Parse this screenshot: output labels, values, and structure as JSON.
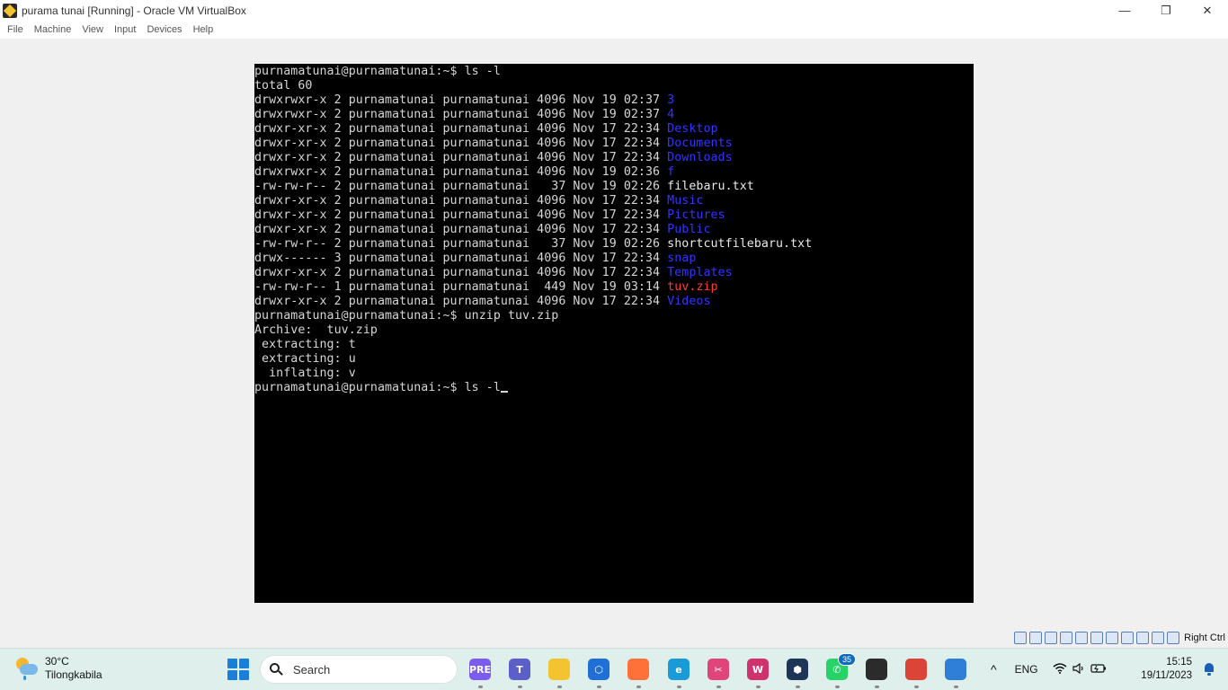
{
  "window": {
    "title": "purama tunai [Running] - Oracle VM VirtualBox",
    "controls": {
      "minimize": "—",
      "restore": "❐",
      "close": "✕"
    }
  },
  "menu": [
    "File",
    "Machine",
    "View",
    "Input",
    "Devices",
    "Help"
  ],
  "terminal": {
    "lines": [
      [
        {
          "t": "purnamatunai@purnamatunai:~$ ls -l",
          "c": ""
        }
      ],
      [
        {
          "t": "total 60",
          "c": ""
        }
      ],
      [
        {
          "t": "drwxrwxr-x 2 purnamatunai purnamatunai 4096 Nov 19 02:37 ",
          "c": ""
        },
        {
          "t": "3",
          "c": "dir"
        }
      ],
      [
        {
          "t": "drwxrwxr-x 2 purnamatunai purnamatunai 4096 Nov 19 02:37 ",
          "c": ""
        },
        {
          "t": "4",
          "c": "dir"
        }
      ],
      [
        {
          "t": "drwxr-xr-x 2 purnamatunai purnamatunai 4096 Nov 17 22:34 ",
          "c": ""
        },
        {
          "t": "Desktop",
          "c": "dir"
        }
      ],
      [
        {
          "t": "drwxr-xr-x 2 purnamatunai purnamatunai 4096 Nov 17 22:34 ",
          "c": ""
        },
        {
          "t": "Documents",
          "c": "dir"
        }
      ],
      [
        {
          "t": "drwxr-xr-x 2 purnamatunai purnamatunai 4096 Nov 17 22:34 ",
          "c": ""
        },
        {
          "t": "Downloads",
          "c": "dir"
        }
      ],
      [
        {
          "t": "drwxrwxr-x 2 purnamatunai purnamatunai 4096 Nov 19 02:36 ",
          "c": ""
        },
        {
          "t": "f",
          "c": "dir"
        }
      ],
      [
        {
          "t": "-rw-rw-r-- 2 purnamatunai purnamatunai   37 Nov 19 02:26 ",
          "c": ""
        },
        {
          "t": "filebaru.txt",
          "c": "file"
        }
      ],
      [
        {
          "t": "drwxr-xr-x 2 purnamatunai purnamatunai 4096 Nov 17 22:34 ",
          "c": ""
        },
        {
          "t": "Music",
          "c": "dir"
        }
      ],
      [
        {
          "t": "drwxr-xr-x 2 purnamatunai purnamatunai 4096 Nov 17 22:34 ",
          "c": ""
        },
        {
          "t": "Pictures",
          "c": "dir"
        }
      ],
      [
        {
          "t": "drwxr-xr-x 2 purnamatunai purnamatunai 4096 Nov 17 22:34 ",
          "c": ""
        },
        {
          "t": "Public",
          "c": "dir"
        }
      ],
      [
        {
          "t": "-rw-rw-r-- 2 purnamatunai purnamatunai   37 Nov 19 02:26 ",
          "c": ""
        },
        {
          "t": "shortcutfilebaru.txt",
          "c": "file"
        }
      ],
      [
        {
          "t": "drwx------ 3 purnamatunai purnamatunai 4096 Nov 17 22:34 ",
          "c": ""
        },
        {
          "t": "snap",
          "c": "dir"
        }
      ],
      [
        {
          "t": "drwxr-xr-x 2 purnamatunai purnamatunai 4096 Nov 17 22:34 ",
          "c": ""
        },
        {
          "t": "Templates",
          "c": "dir"
        }
      ],
      [
        {
          "t": "-rw-rw-r-- 1 purnamatunai purnamatunai  449 Nov 19 03:14 ",
          "c": ""
        },
        {
          "t": "tuv.zip",
          "c": "zip"
        }
      ],
      [
        {
          "t": "drwxr-xr-x 2 purnamatunai purnamatunai 4096 Nov 17 22:34 ",
          "c": ""
        },
        {
          "t": "Videos",
          "c": "dir"
        }
      ],
      [
        {
          "t": "purnamatunai@purnamatunai:~$ unzip tuv.zip",
          "c": ""
        }
      ],
      [
        {
          "t": "Archive:  tuv.zip",
          "c": ""
        }
      ],
      [
        {
          "t": " extracting: t",
          "c": ""
        }
      ],
      [
        {
          "t": " extracting: u",
          "c": ""
        }
      ],
      [
        {
          "t": "  inflating: v",
          "c": ""
        }
      ],
      [
        {
          "t": "purnamatunai@purnamatunai:~$ ls -l",
          "c": "",
          "cursor": true
        }
      ]
    ]
  },
  "status_bar": {
    "icons": [
      "optical-drive-icon",
      "audio-icon",
      "network-icon",
      "usb-icon",
      "shared-folders-icon",
      "display-icon",
      "recording-icon",
      "cpu-icon",
      "guest-additions-icon",
      "mouse-integration-icon",
      "keyboard-icon"
    ],
    "host_key": "Right Ctrl"
  },
  "taskbar": {
    "weather": {
      "temp": "30°C",
      "location": "Tilongkabila"
    },
    "search_placeholder": "Search",
    "apps": [
      {
        "name": "copilot-icon",
        "label": "PRE",
        "color": "#7a5cf0"
      },
      {
        "name": "teams-icon",
        "label": "T",
        "color": "#5b5fc7"
      },
      {
        "name": "file-explorer-icon",
        "label": "",
        "color": "#f4c430"
      },
      {
        "name": "vpn-app-icon",
        "label": "⬡",
        "color": "#1f6fd6"
      },
      {
        "name": "firefox-icon",
        "label": "",
        "color": "#ff7139"
      },
      {
        "name": "edge-icon",
        "label": "e",
        "color": "#1a9bd7"
      },
      {
        "name": "snipping-tool-icon",
        "label": "✂",
        "color": "#e0447b"
      },
      {
        "name": "wps-office-icon",
        "label": "W",
        "color": "#d0326e"
      },
      {
        "name": "virtualbox-icon",
        "label": "⬢",
        "color": "#1d3557"
      },
      {
        "name": "whatsapp-icon",
        "label": "✆",
        "color": "#25d366",
        "badge": "35"
      },
      {
        "name": "running-vm-icon",
        "label": "",
        "color": "#2b2b2b"
      },
      {
        "name": "chrome-icon",
        "label": "",
        "color": "#db4437"
      },
      {
        "name": "photos-icon",
        "label": "",
        "color": "#2f7ed8"
      }
    ],
    "tray": {
      "chevron": "^",
      "language": "ENG"
    },
    "clock": {
      "time": "15:15",
      "date": "19/11/2023"
    }
  }
}
